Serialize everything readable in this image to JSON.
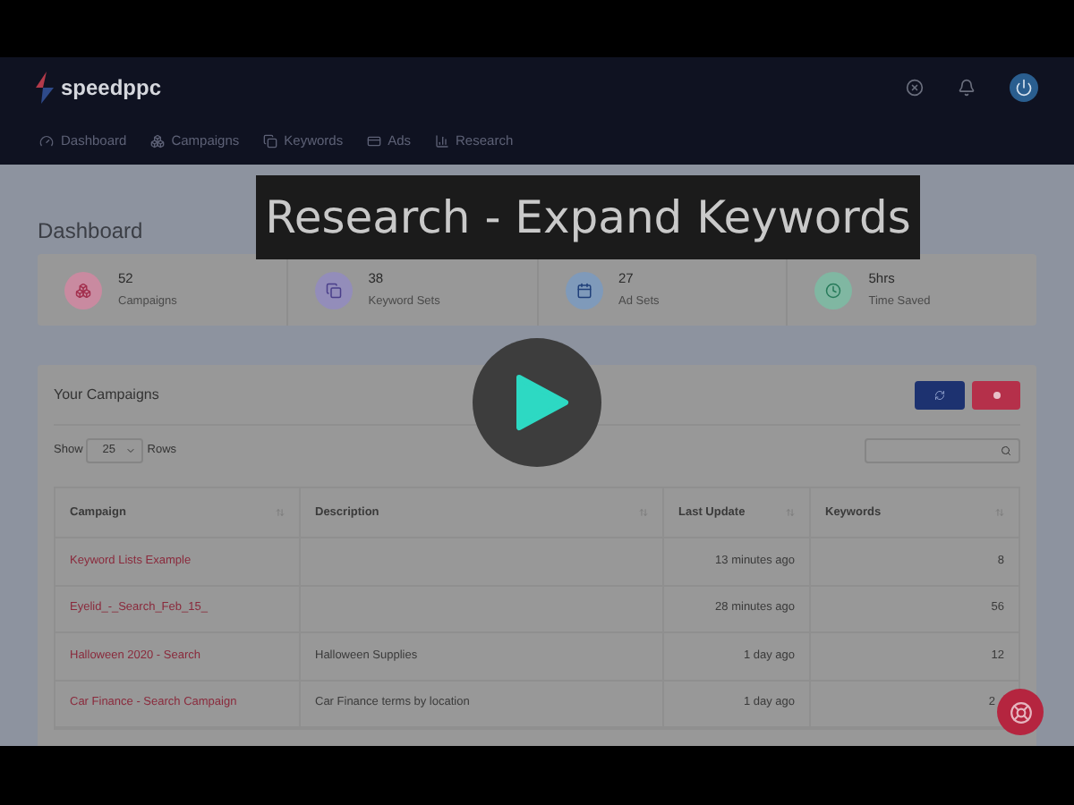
{
  "header": {
    "logo": "speedppc",
    "nav": [
      "Dashboard",
      "Campaigns",
      "Keywords",
      "Ads",
      "Research"
    ]
  },
  "video": {
    "title": "Research - Expand Keywords"
  },
  "page_title": "Dashboard",
  "stats": [
    {
      "value": "52",
      "label": "Campaigns",
      "color": "#c98aa0"
    },
    {
      "value": "38",
      "label": "Keyword Sets",
      "color": "#938dba"
    },
    {
      "value": "27",
      "label": "Ad Sets",
      "color": "#7f9aba"
    },
    {
      "value": "5hrs",
      "label": "Time Saved",
      "color": "#80b7a2"
    }
  ],
  "campaigns": {
    "title": "Your Campaigns",
    "show_label": "Show",
    "rows_value": "25",
    "rows_label": "Rows",
    "columns": [
      "Campaign",
      "Description",
      "Last Update",
      "Keywords"
    ],
    "rows": [
      {
        "campaign": "Keyword Lists Example",
        "description": "",
        "last_update": "13 minutes ago",
        "keywords": "8"
      },
      {
        "campaign": "Eyelid_-_Search_Feb_15_",
        "description": "",
        "last_update": "28 minutes ago",
        "keywords": "56"
      },
      {
        "campaign": "Halloween 2020 - Search",
        "description": "Halloween Supplies",
        "last_update": "1 day ago",
        "keywords": "12"
      },
      {
        "campaign": "Car Finance - Search Campaign",
        "description": "Car Finance terms by location",
        "last_update": "1 day ago",
        "keywords": "2"
      }
    ]
  }
}
